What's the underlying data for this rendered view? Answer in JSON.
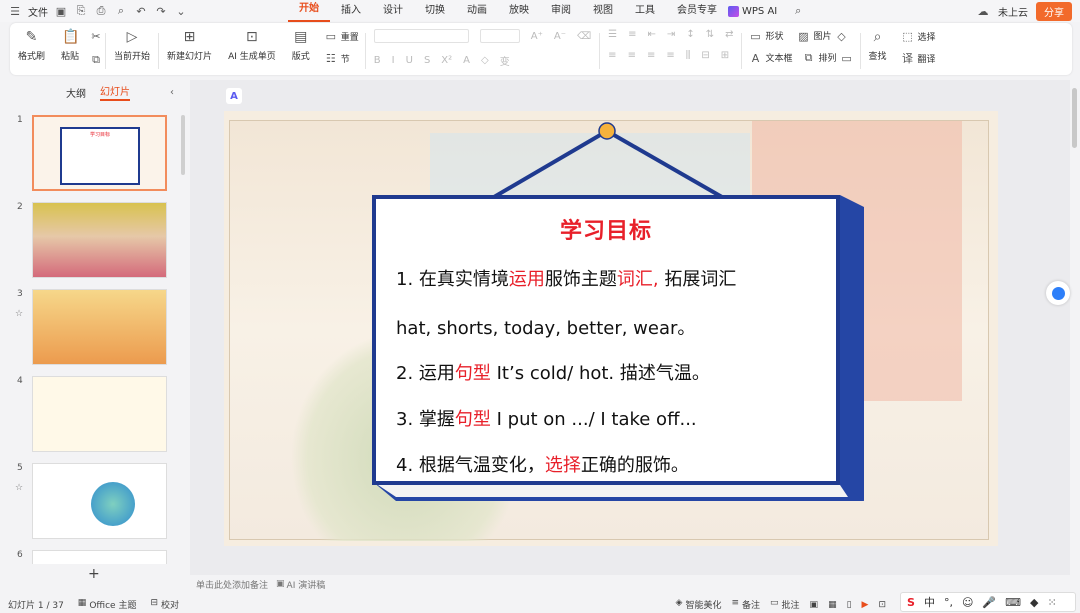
{
  "menubar": {
    "file_label": "文件",
    "menus": [
      "开始",
      "插入",
      "设计",
      "切换",
      "动画",
      "放映",
      "审阅",
      "视图",
      "工具",
      "会员专享"
    ],
    "active_menu": "开始",
    "wps_ai_label": "WPS AI",
    "cloud_label": "未上云",
    "share_label": "分享"
  },
  "ribbon": {
    "format_painter": "格式刷",
    "paste": "粘贴",
    "play_from_current": "当前开始",
    "new_slide": "新建幻灯片",
    "ai_page": "AI 生成单页",
    "layout": "版式",
    "reset": "重置",
    "section": "节",
    "shape": "形状",
    "image": "图片",
    "textbox": "文本框",
    "arrange": "排列",
    "find": "查找",
    "select": "选择",
    "translate": "翻译"
  },
  "leftpanel": {
    "tab_outline": "大纲",
    "tab_slides": "幻灯片",
    "slide_numbers": [
      "1",
      "2",
      "3",
      "4",
      "5",
      "6"
    ],
    "add_label": "+"
  },
  "slide": {
    "title": "学习目标",
    "line1_a": "1.   在真实情境",
    "line1_b": "运用",
    "line1_c": "服饰主题",
    "line1_d": "词汇,",
    "line1_e": " 拓展词汇",
    "line2": "hat, shorts, today, better, wear。",
    "line3_a": "2.   运用",
    "line3_b": "句型",
    "line3_c": "  It’s cold/ hot. 描述气温。",
    "line4_a": "3.   掌握",
    "line4_b": "句型",
    "line4_c": "  I put on .../ I take off...",
    "line5_a": "4.   根据气温变化，",
    "line5_b": "选择",
    "line5_c": "正确的服饰。"
  },
  "notes": {
    "placeholder": "单击此处添加备注",
    "ai_speech": "AI 演讲稿"
  },
  "statusbar": {
    "slide_count": "幻灯片 1 / 37",
    "theme": "Office 主题",
    "proofread": "校对",
    "beautify": "智能美化",
    "notes_btn": "备注",
    "comments_btn": "批注"
  },
  "ime": {
    "lang": "中"
  },
  "colors": {
    "accent": "#e84d1c",
    "board_border": "#1f3a8f",
    "title_red": "#e8202a"
  }
}
